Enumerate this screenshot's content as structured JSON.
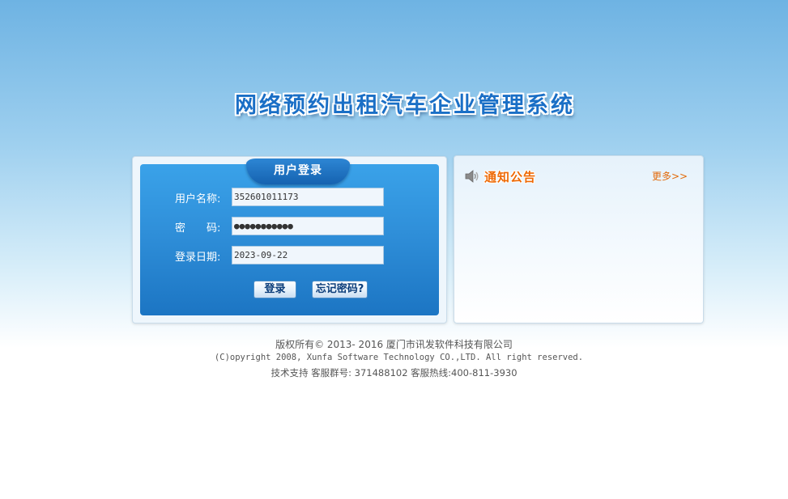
{
  "header": {
    "title": "网络预约出租汽车企业管理系统"
  },
  "login": {
    "tab_label": "用户登录",
    "username_label": "用户名称:",
    "username_value": "352601011173",
    "password_label": "密　　码:",
    "password_value": "●●●●●●●●●●●",
    "date_label": "登录日期:",
    "date_value": "2023-09-22",
    "login_button": "登录",
    "forgot_button": "忘记密码?"
  },
  "notice": {
    "title": "通知公告",
    "more_link": "更多>>",
    "items": []
  },
  "footer": {
    "line1": "版权所有© 2013- 2016 厦门市讯发软件科技有限公司",
    "line2": "(C)opyright 2008, Xunfa Software Technology CO.,LTD. All right reserved.",
    "line3": "技术支持 客服群号: 371488102 客服热线:400-811-3930"
  },
  "colors": {
    "accent_blue": "#2f8fd9",
    "notice_orange": "#ee6a06",
    "title_blue": "#1a6fc6"
  },
  "icons": {
    "speaker": "speaker-icon"
  }
}
